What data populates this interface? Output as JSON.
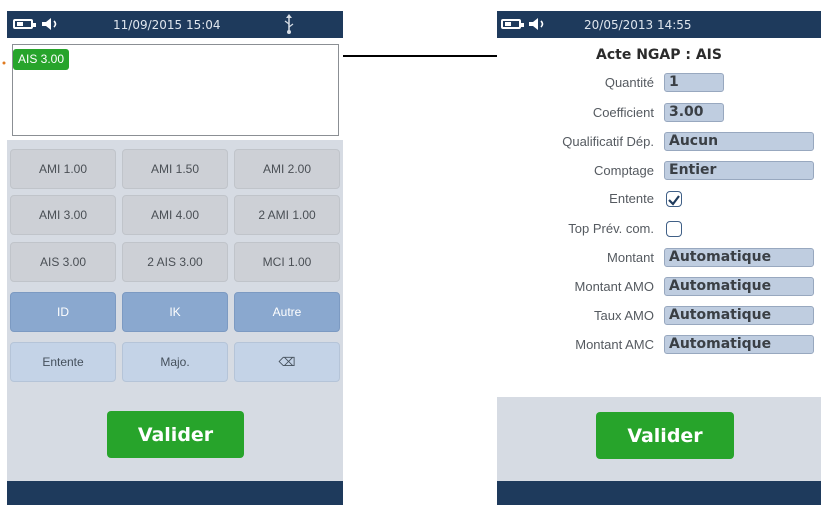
{
  "left_screen": {
    "status_time": "11/09/2015 15:04",
    "selected_act": "AIS 3.00",
    "keys": [
      {
        "label": "AMI 1.00",
        "style": "grey"
      },
      {
        "label": "AMI 1.50",
        "style": "grey"
      },
      {
        "label": "AMI 2.00",
        "style": "grey"
      },
      {
        "label": "AMI 3.00",
        "style": "grey"
      },
      {
        "label": "AMI 4.00",
        "style": "grey"
      },
      {
        "label": "2 AMI 1.00",
        "style": "grey"
      },
      {
        "label": "AIS 3.00",
        "style": "grey"
      },
      {
        "label": "2 AIS 3.00",
        "style": "grey"
      },
      {
        "label": "MCI 1.00",
        "style": "grey"
      },
      {
        "label": "ID",
        "style": "blue"
      },
      {
        "label": "IK",
        "style": "blue"
      },
      {
        "label": "Autre",
        "style": "blue"
      },
      {
        "label": "Entente",
        "style": "light"
      },
      {
        "label": "Majo.",
        "style": "light"
      },
      {
        "label": "⌫",
        "style": "light"
      }
    ],
    "validate_label": "Valider"
  },
  "right_screen": {
    "status_time": "20/05/2013 14:55",
    "title": "Acte NGAP : AIS",
    "fields": {
      "quantite": {
        "label": "Quantité",
        "value": "1"
      },
      "coefficient": {
        "label": "Coefficient",
        "value": "3.00"
      },
      "qualificatif": {
        "label": "Qualificatif Dép.",
        "value": "Aucun"
      },
      "comptage": {
        "label": "Comptage",
        "value": "Entier"
      },
      "entente": {
        "label": "Entente",
        "checked": true
      },
      "top_prev": {
        "label": "Top Prév. com.",
        "checked": false
      },
      "montant": {
        "label": "Montant",
        "value": "Automatique"
      },
      "montant_amo": {
        "label": "Montant AMO",
        "value": "Automatique"
      },
      "taux_amo": {
        "label": "Taux AMO",
        "value": "Automatique"
      },
      "montant_amc": {
        "label": "Montant AMC",
        "value": "Automatique"
      }
    },
    "validate_label": "Valider"
  },
  "colors": {
    "status_bar": "#1e3a5c",
    "accent_green": "#27a42b",
    "key_grey": "#cdd0d6",
    "key_blue": "#8aa8cf",
    "key_light": "#c4d3e7",
    "field_bg": "#bfcde0"
  },
  "icons": [
    "battery-icon",
    "speaker-icon",
    "usb-icon",
    "checkmark-icon",
    "arrow-connector-icon"
  ]
}
